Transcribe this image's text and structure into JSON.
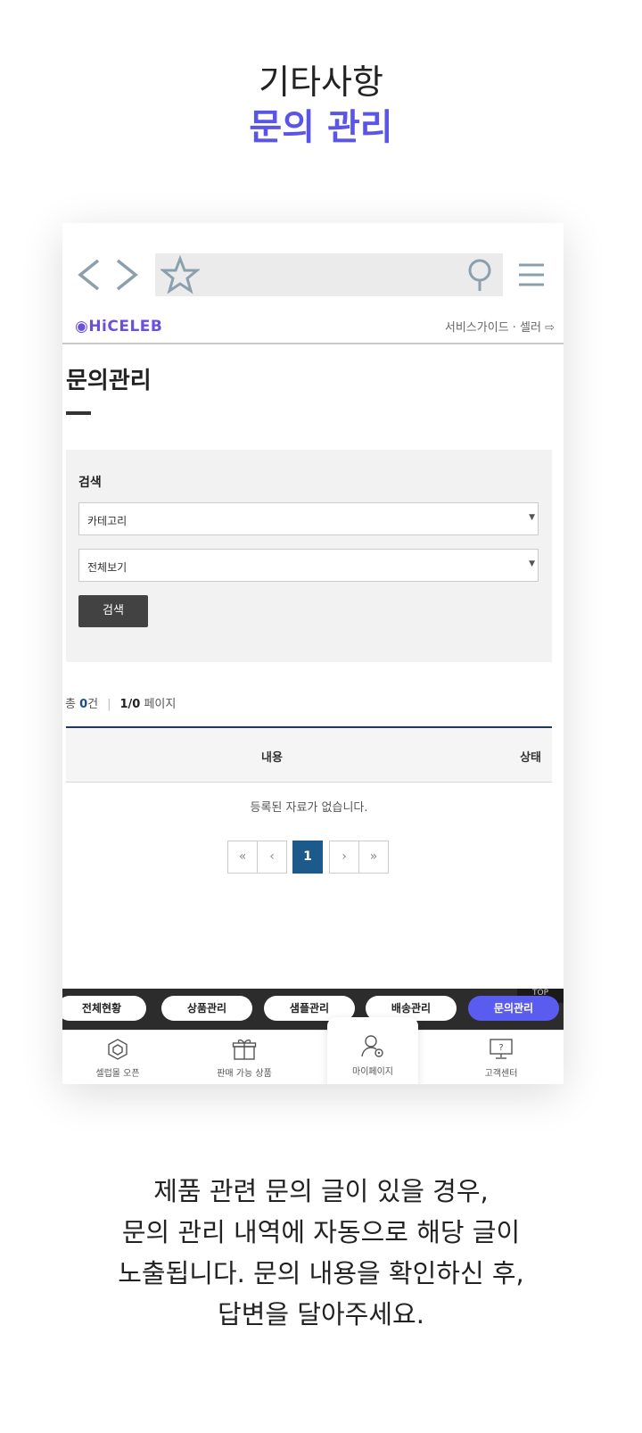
{
  "headline": {
    "subtitle": "기타사항",
    "title": "문의 관리"
  },
  "browser": {
    "url": ""
  },
  "site": {
    "logo": "◉HiCELEB",
    "header_links": "서비스가이드 · 셀러 ⇨"
  },
  "page": {
    "title": "문의관리",
    "search": {
      "label": "검색",
      "category_select": "카테고리",
      "view_select": "전체보기",
      "button": "검색"
    },
    "count": {
      "total_prefix": "총 ",
      "total_num": "0",
      "total_suffix": "건",
      "page_info": "1/0",
      "page_suffix": " 페이지"
    },
    "table": {
      "headers": [
        "내용",
        "상태"
      ],
      "empty_message": "등록된 자료가 없습니다."
    },
    "pagination": {
      "first": "«",
      "prev": "‹",
      "current": "1",
      "next": "›",
      "last": "»"
    }
  },
  "tabs": [
    "전체현황",
    "상품관리",
    "샘플관리",
    "배송관리",
    "문의관리"
  ],
  "tabs_active_index": 4,
  "top_tag": "TOP",
  "bottom_nav": [
    {
      "label": "셀럽몰 오픈",
      "icon": "hexagon-icon"
    },
    {
      "label": "판매 가능 상품",
      "icon": "gift-icon"
    },
    {
      "label": "마이페이지",
      "icon": "user-settings-icon"
    },
    {
      "label": "고객센터",
      "icon": "monitor-help-icon"
    }
  ],
  "caption": [
    "제품 관련 문의 글이 있을 경우,",
    "문의 관리 내역에 자동으로 해당 글이",
    "노출됩니다. 문의 내용을 확인하신 후,",
    "답변을 달아주세요."
  ],
  "colors": {
    "accent": "#5a55e8",
    "tab_active": "#5a5cf0",
    "pager_active": "#1d5a8c",
    "table_border": "#1d3a5c"
  }
}
